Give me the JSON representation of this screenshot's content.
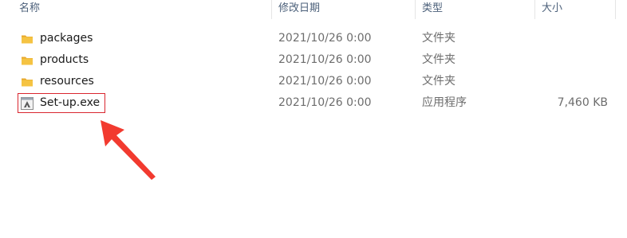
{
  "columns": {
    "name": "名称",
    "modified": "修改日期",
    "type": "类型",
    "size": "大小"
  },
  "files": [
    {
      "name": "packages",
      "modified": "2021/10/26 0:00",
      "type": "文件夹",
      "size": "",
      "icon": "folder-icon"
    },
    {
      "name": "products",
      "modified": "2021/10/26 0:00",
      "type": "文件夹",
      "size": "",
      "icon": "folder-icon"
    },
    {
      "name": "resources",
      "modified": "2021/10/26 0:00",
      "type": "文件夹",
      "size": "",
      "icon": "folder-icon"
    },
    {
      "name": "Set-up.exe",
      "modified": "2021/10/26 0:00",
      "type": "应用程序",
      "size": "7,460 KB",
      "icon": "application-icon"
    }
  ],
  "annotation": {
    "highlight_color": "#d9262f",
    "arrow_color": "#f23a2f"
  },
  "colors": {
    "folder": "#f5c342",
    "header_text": "#4c607a"
  }
}
